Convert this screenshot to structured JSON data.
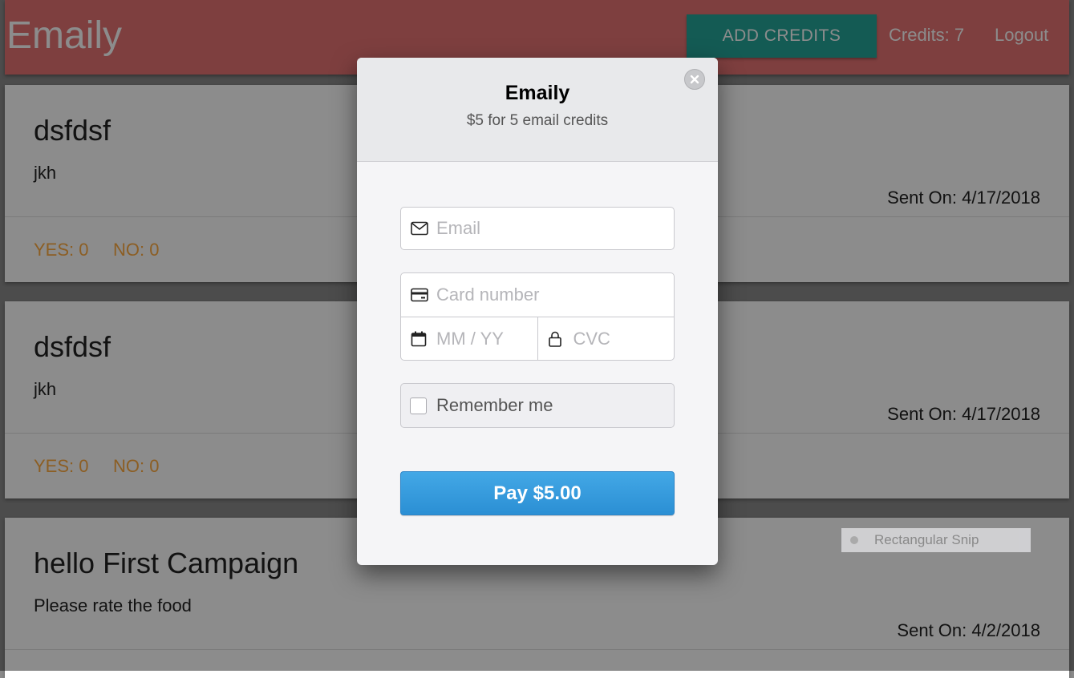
{
  "navbar": {
    "brand": "Emaily",
    "add_credits": "ADD CREDITS",
    "credits": "Credits: 7",
    "logout": "Logout"
  },
  "surveys": [
    {
      "title": "dsfdsf",
      "body": "jkh",
      "sent_on": "Sent On: 4/17/2018",
      "yes": "YES: 0",
      "no": "NO: 0"
    },
    {
      "title": "dsfdsf",
      "body": "jkh",
      "sent_on": "Sent On: 4/17/2018",
      "yes": "YES: 0",
      "no": "NO: 0"
    },
    {
      "title": "hello First Campaign",
      "body": "Please rate the food",
      "sent_on": "Sent On: 4/2/2018"
    }
  ],
  "snip_tool": {
    "label": "Rectangular Snip"
  },
  "checkout": {
    "title": "Emaily",
    "subtitle": "$5 for 5 email credits",
    "email_placeholder": "Email",
    "card_placeholder": "Card number",
    "expiry_placeholder": "MM / YY",
    "cvc_placeholder": "CVC",
    "remember_label": "Remember me",
    "pay_label": "Pay $5.00"
  },
  "icons": {
    "close": "close-icon",
    "email": "envelope-icon",
    "card": "credit-card-icon",
    "expiry": "calendar-icon",
    "cvc": "lock-icon"
  },
  "colors": {
    "navbar": "#e57373",
    "add_credits": "#26a69a",
    "yes_no": "#ffab40",
    "pay_button": "#3399dd"
  }
}
